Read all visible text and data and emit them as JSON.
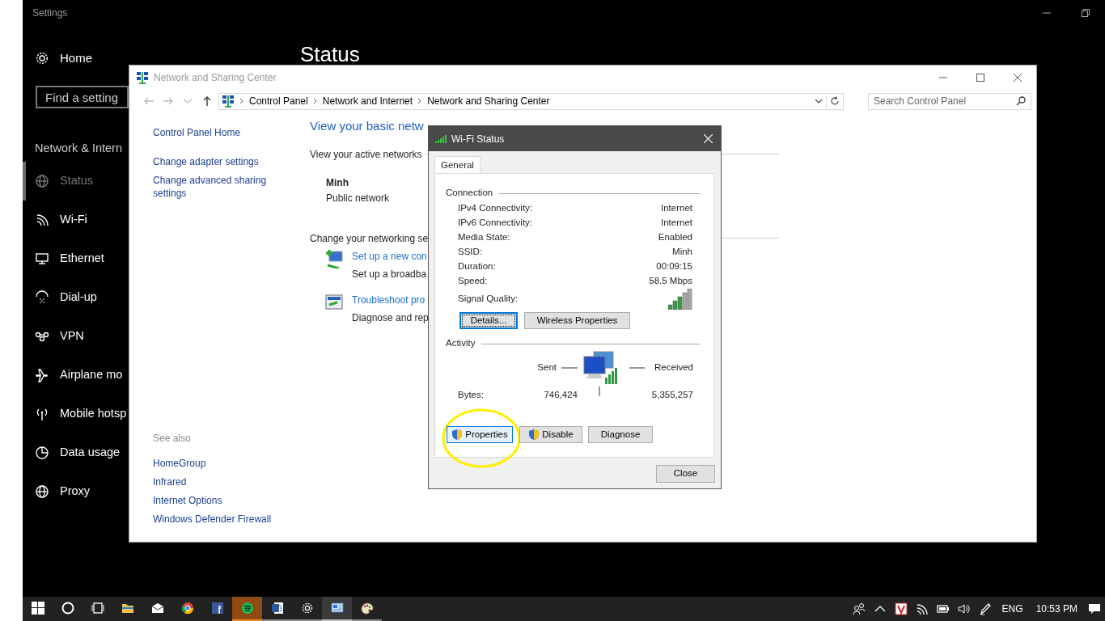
{
  "settings": {
    "title": "Settings",
    "heading": "Status",
    "home": "Home",
    "search": {
      "placeholder": "Find a setting"
    },
    "section": "Network & Intern",
    "items": [
      {
        "label": "Status",
        "selected": true
      },
      {
        "label": "Wi-Fi",
        "selected": false
      },
      {
        "label": "Ethernet",
        "selected": false
      },
      {
        "label": "Dial-up",
        "selected": false
      },
      {
        "label": "VPN",
        "selected": false
      },
      {
        "label": "Airplane mo",
        "selected": false
      },
      {
        "label": "Mobile hotsp",
        "selected": false
      },
      {
        "label": "Data usage",
        "selected": false
      },
      {
        "label": "Proxy",
        "selected": false
      }
    ]
  },
  "control_panel": {
    "title": "Network and Sharing Center",
    "breadcrumb": [
      "Control Panel",
      "Network and Internet",
      "Network and Sharing Center"
    ],
    "search": {
      "placeholder": "Search Control Panel"
    },
    "sidebar": {
      "links": [
        "Control Panel Home",
        "Change adapter settings",
        "Change advanced sharing settings"
      ],
      "see_also_title": "See also",
      "see_also": [
        "HomeGroup",
        "Infrared",
        "Internet Options",
        "Windows Defender Firewall"
      ]
    },
    "main": {
      "heading": "View your basic netw",
      "active_networks_title": "View your active networks",
      "network": {
        "name": "Minh",
        "type": "Public network"
      },
      "settings_title": "Change your networking se",
      "tasks": [
        {
          "link": "Set up a new con",
          "description": "Set up a broadba"
        },
        {
          "link": "Troubleshoot pro",
          "description": "Diagnose and rep"
        }
      ]
    }
  },
  "dialog": {
    "title": "Wi-Fi Status",
    "tabs": [
      {
        "label": "General",
        "selected": true
      }
    ],
    "connection": {
      "title": "Connection",
      "rows": [
        {
          "label": "IPv4 Connectivity:",
          "value": "Internet"
        },
        {
          "label": "IPv6 Connectivity:",
          "value": "Internet"
        },
        {
          "label": "Media State:",
          "value": "Enabled"
        },
        {
          "label": "SSID:",
          "value": "Minh"
        },
        {
          "label": "Duration:",
          "value": "00:09:15"
        },
        {
          "label": "Speed:",
          "value": "58.5 Mbps"
        }
      ],
      "signal_label": "Signal Quality:"
    },
    "connection_buttons": [
      {
        "label": "Details...",
        "focused": true
      },
      {
        "label": "Wireless Properties",
        "focused": false
      }
    ],
    "activity": {
      "title": "Activity",
      "sent_label": "Sent",
      "received_label": "Received",
      "bytes_label": "Bytes:",
      "sent": "746,424",
      "received": "5,355,257"
    },
    "action_buttons": [
      {
        "label": "Properties",
        "shield": true,
        "hovered": true
      },
      {
        "label": "Disable",
        "shield": true,
        "hovered": false
      },
      {
        "label": "Diagnose",
        "shield": false,
        "hovered": false
      }
    ],
    "close_label": "Close"
  },
  "taskbar": {
    "apps": [
      {
        "running": false,
        "attention": false,
        "selected": false
      },
      {
        "running": false,
        "attention": false,
        "selected": false
      },
      {
        "running": false,
        "attention": false,
        "selected": false
      },
      {
        "running": false,
        "attention": false,
        "selected": false
      },
      {
        "running": true,
        "attention": true,
        "selected": false
      },
      {
        "running": true,
        "attention": false,
        "selected": false
      },
      {
        "running": true,
        "attention": false,
        "selected": false
      },
      {
        "running": true,
        "attention": false,
        "selected": true
      },
      {
        "running": true,
        "attention": false,
        "selected": false
      }
    ],
    "language": "ENG",
    "time": "10:53 PM"
  }
}
